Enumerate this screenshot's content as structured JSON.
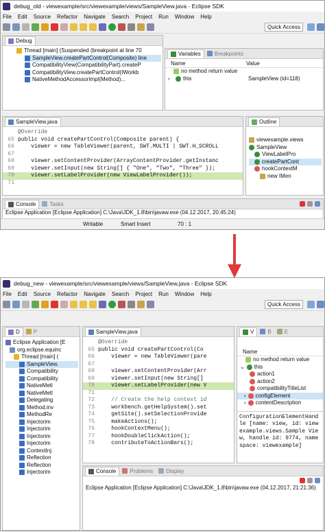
{
  "old": {
    "title": "debug_old - viewexample/src/viewexample/views/SampleView.java - Eclipse SDK",
    "menu": [
      "File",
      "Edit",
      "Source",
      "Refactor",
      "Navigate",
      "Search",
      "Project",
      "Run",
      "Window",
      "Help"
    ],
    "quick_access": "Quick Access",
    "debug_tab": "Debug",
    "debug_lines": [
      "Thread [main] (Suspended (breakpoint at line 70",
      "SampleView.createPartControl(Composite) line",
      "CompatibilityView(CompatibilityPart).createP",
      "CompatibilityView.createPartControl(IWorkb",
      "NativeMethodAccessorImpl(Method)..."
    ],
    "vars_tabs": [
      "Variables",
      "Breakpoints"
    ],
    "vars_headers": [
      "Name",
      "Value"
    ],
    "vars_rows": [
      {
        "name": "no method return value",
        "value": ""
      },
      {
        "name": "this",
        "value": "SampleView (id=118)"
      }
    ],
    "editor_tab": "SampleView.java",
    "code": [
      {
        "n": "",
        "t": "@Override"
      },
      {
        "n": "65",
        "t": "public void createPartControl(Composite parent) {"
      },
      {
        "n": "66",
        "t": "    viewer = new TableViewer(parent, SWT.MULTI | SWT.H_SCROLL"
      },
      {
        "n": "67",
        "t": ""
      },
      {
        "n": "68",
        "t": "    viewer.setContentProvider(ArrayContentProvider.getInstanc"
      },
      {
        "n": "69",
        "t": "    viewer.setInput(new String[] { \"One\", \"Two\", \"Three\" });"
      },
      {
        "n": "70",
        "t": "    viewer.setLabelProvider(new ViewLabelProvider());"
      },
      {
        "n": "71",
        "t": ""
      }
    ],
    "outline_tab": "Outline",
    "outline": [
      "viewexample.views",
      "SampleView",
      "ViewLabelPro",
      "createPartCont",
      "hookContextM",
      "new IMen"
    ],
    "console_tabs": [
      "Console",
      "Tasks"
    ],
    "console_text": "Eclipse Application [Eclipse Application] C:\\Java\\JDK_1.8\\bin\\javaw.exe (04.12.2017, 20:45:24)",
    "status": {
      "writable": "Writable",
      "insert": "Smart Insert",
      "pos": "70 : 1"
    }
  },
  "new": {
    "title": "debug_new - viewexample/src/viewexample/views/SampleView.java - Eclipse SDK",
    "menu": [
      "File",
      "Edit",
      "Source",
      "Refactor",
      "Navigate",
      "Search",
      "Project",
      "Run",
      "Window",
      "Help"
    ],
    "quick_access": "Quick Access",
    "debug_tabs": [
      "D",
      "P"
    ],
    "debug_lines": [
      "Eclipse Application [E",
      "org.eclipse.equinc",
      "Thread [main] (",
      "SampleView.",
      "Compatibility",
      "Compatibility",
      "NativeMetl",
      "NativeMetl",
      "Delegating",
      "Method.inv",
      "MethodRe",
      "Injectorim",
      "Injectorim",
      "Injectorim",
      "Injectorim",
      "ContextInj",
      "Reflection",
      "Reflection",
      "Injectorim"
    ],
    "editor_tab": "SampleView.java",
    "code": [
      {
        "n": "",
        "t": "@Override"
      },
      {
        "n": "65",
        "t": "public void createPartControl(Co"
      },
      {
        "n": "66",
        "t": "    viewer = new TableViewer(pare"
      },
      {
        "n": "67",
        "t": ""
      },
      {
        "n": "68",
        "t": "    viewer.setContentProvider(Arr"
      },
      {
        "n": "69",
        "t": "    viewer.setInput(new String[]"
      },
      {
        "n": "70",
        "t": "    viewer.setLabelProvider(new V"
      },
      {
        "n": "71",
        "t": ""
      },
      {
        "n": "72",
        "t": "    // Create the help context id"
      },
      {
        "n": "73",
        "t": "    workbench.getHelpSystem().set"
      },
      {
        "n": "74",
        "t": "    getSite().setSelectionProvide"
      },
      {
        "n": "75",
        "t": "    makeActions();"
      },
      {
        "n": "76",
        "t": "    hookContextMenu();"
      },
      {
        "n": "77",
        "t": "    hookDoubleClickAction();"
      },
      {
        "n": "78",
        "t": "    contributeToActionBars();"
      }
    ],
    "vars_tabs": [
      "V",
      "B",
      "E"
    ],
    "vars_headers": [
      "Name"
    ],
    "vars_rows": [
      "no method return value",
      "this",
      "action1",
      "action2",
      "compatibilityTitleList",
      "configElement",
      "contentDescription"
    ],
    "detail": "ConfigurationElementHandle [name: view, id: viewexample.views.Sample View, handle id: 9774, namespace: viewexample]",
    "console_tabs": [
      "Console",
      "Problems",
      "Display"
    ],
    "console_text": "Eclipse Application [Eclipse Application] C:\\Java\\JDK_1.8\\bin\\javaw.exe (04.12.2017, 21:21:36)"
  },
  "colors": {
    "arrow": "#e0393e",
    "highlight": "#cfe8b0",
    "selection": "#cde4f7",
    "keyword": "#7f0055",
    "string": "#2a00ff"
  }
}
